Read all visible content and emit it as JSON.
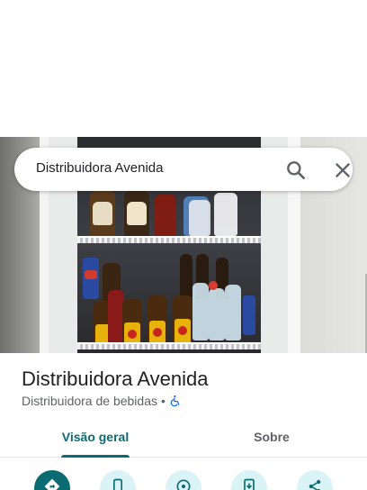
{
  "search": {
    "query": "Distribuidora Avenida"
  },
  "place": {
    "name": "Distribuidora Avenida",
    "category": "Distribuidora de bebidas",
    "separator": "•",
    "accessibility_icon": "wheelchair-icon"
  },
  "tabs": [
    {
      "label": "Visão geral",
      "selected": true
    },
    {
      "label": "Sobre",
      "selected": false
    }
  ],
  "actions": [
    {
      "icon": "directions-icon",
      "primary": true
    },
    {
      "icon": "phone-icon",
      "primary": false
    },
    {
      "icon": "nearby-icon",
      "primary": false
    },
    {
      "icon": "save-to-phone-icon",
      "primary": false
    },
    {
      "icon": "share-icon",
      "primary": false
    }
  ],
  "colors": {
    "accent": "#0b6b72",
    "action_bg": "#d9f3f6",
    "accessibility": "#1a73e8"
  }
}
